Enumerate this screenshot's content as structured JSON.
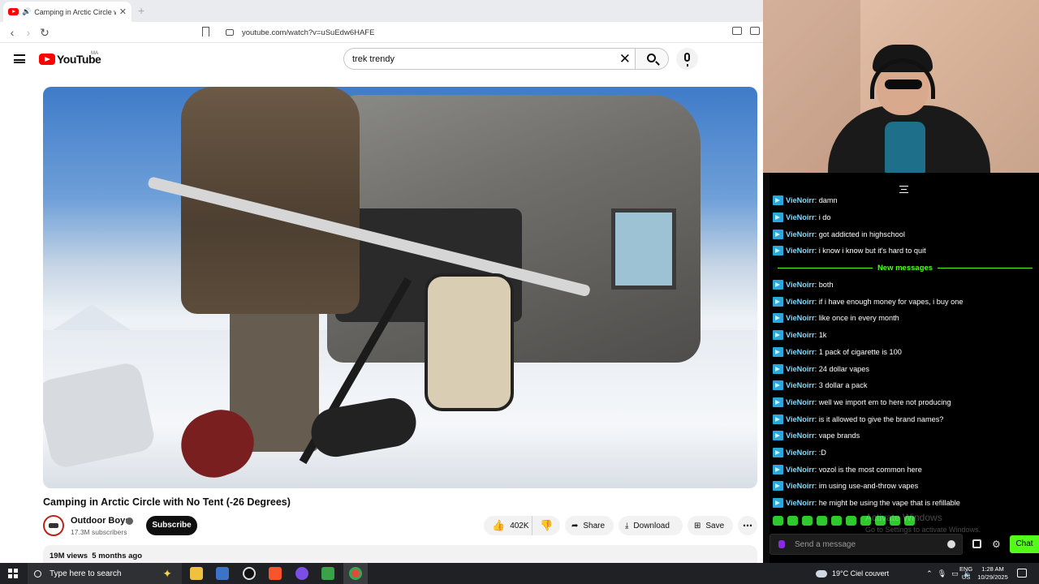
{
  "browser": {
    "tab_title": "Camping in Arctic Circle with",
    "url": "youtube.com/watch?v=uSuEdw6HAFE"
  },
  "youtube": {
    "logo_text": "YouTube",
    "country_code": "MA",
    "search_query": "trek trendy"
  },
  "video": {
    "title": "Camping in Arctic Circle with No Tent (-26 Degrees)",
    "channel": "Outdoor Boys",
    "subscribers": "17.3M subscribers",
    "subscribe_label": "Subscribe",
    "likes": "402K",
    "share_label": "Share",
    "download_label": "Download",
    "save_label": "Save",
    "views": "19M views",
    "age": "5 months ago"
  },
  "chat": {
    "new_messages_label": "New messages",
    "before": [
      {
        "user": "VieNoirr",
        "text": "damn"
      },
      {
        "user": "VieNoirr",
        "text": "i do"
      },
      {
        "user": "VieNoirr",
        "text": "got addicted in highschool"
      },
      {
        "user": "VieNoirr",
        "text": "i know i know but it's hard to quit"
      }
    ],
    "after": [
      {
        "user": "VieNoirr",
        "text": "both"
      },
      {
        "user": "VieNoirr",
        "text": "if i have enough money for vapes, i buy one"
      },
      {
        "user": "VieNoirr",
        "text": "like once in every month"
      },
      {
        "user": "VieNoirr",
        "text": "1k"
      },
      {
        "user": "VieNoirr",
        "text": "1 pack of cigarette is 100"
      },
      {
        "user": "VieNoirr",
        "text": "24 dollar vapes"
      },
      {
        "user": "VieNoirr",
        "text": "3 dollar a pack"
      },
      {
        "user": "VieNoirr",
        "text": "well we import em to here not producing"
      },
      {
        "user": "VieNoirr",
        "text": "is it allowed to give the brand names?"
      },
      {
        "user": "VieNoirr",
        "text": "vape brands"
      },
      {
        "user": "VieNoirr",
        "text": ":D"
      },
      {
        "user": "VieNoirr",
        "text": "vozol is the most common here"
      },
      {
        "user": "VieNoirr",
        "text": "im using use-and-throw vapes"
      },
      {
        "user": "VieNoirr",
        "text": "he might be using the vape that is refillable"
      }
    ],
    "send_placeholder": "Send a message",
    "chat_button": "Chat",
    "watermark_line1": "Activate Windows",
    "watermark_line2": "Go to Settings to activate Windows."
  },
  "taskbar": {
    "search_placeholder": "Type here to search",
    "weather": "19°C  Ciel couvert",
    "lang_top": "ENG",
    "lang_bottom": "US",
    "time": "1:28 AM",
    "date": "10/29/2025"
  },
  "colors": {
    "youtube_red": "#ff0000",
    "chat_accent": "#53fc18",
    "chat_username": "#7ddcff"
  }
}
